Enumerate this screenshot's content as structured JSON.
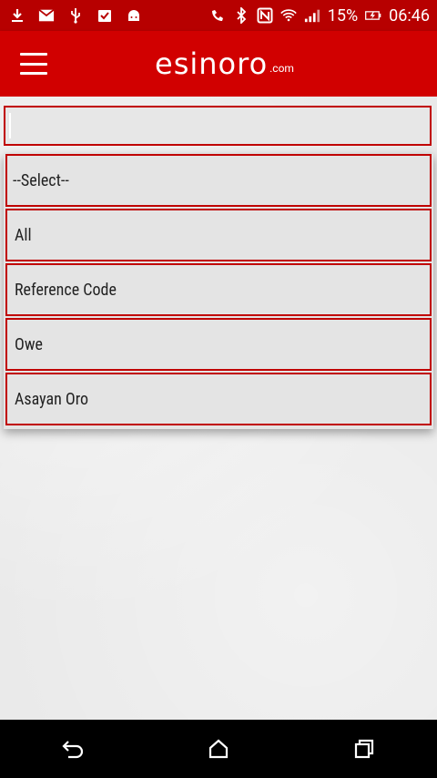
{
  "status_bar": {
    "battery": "15%",
    "time": "06:46"
  },
  "app_bar": {
    "logo_text": "esinoro",
    "logo_suffix": ".com"
  },
  "search": {
    "value": ""
  },
  "dropdown": {
    "options": [
      {
        "label": "--Select--"
      },
      {
        "label": "All"
      },
      {
        "label": "Reference Code"
      },
      {
        "label": "Owe"
      },
      {
        "label": "Asayan Oro"
      }
    ]
  },
  "colors": {
    "statusbar": "#b70000",
    "appbar": "#d10000",
    "border": "#c00000"
  }
}
